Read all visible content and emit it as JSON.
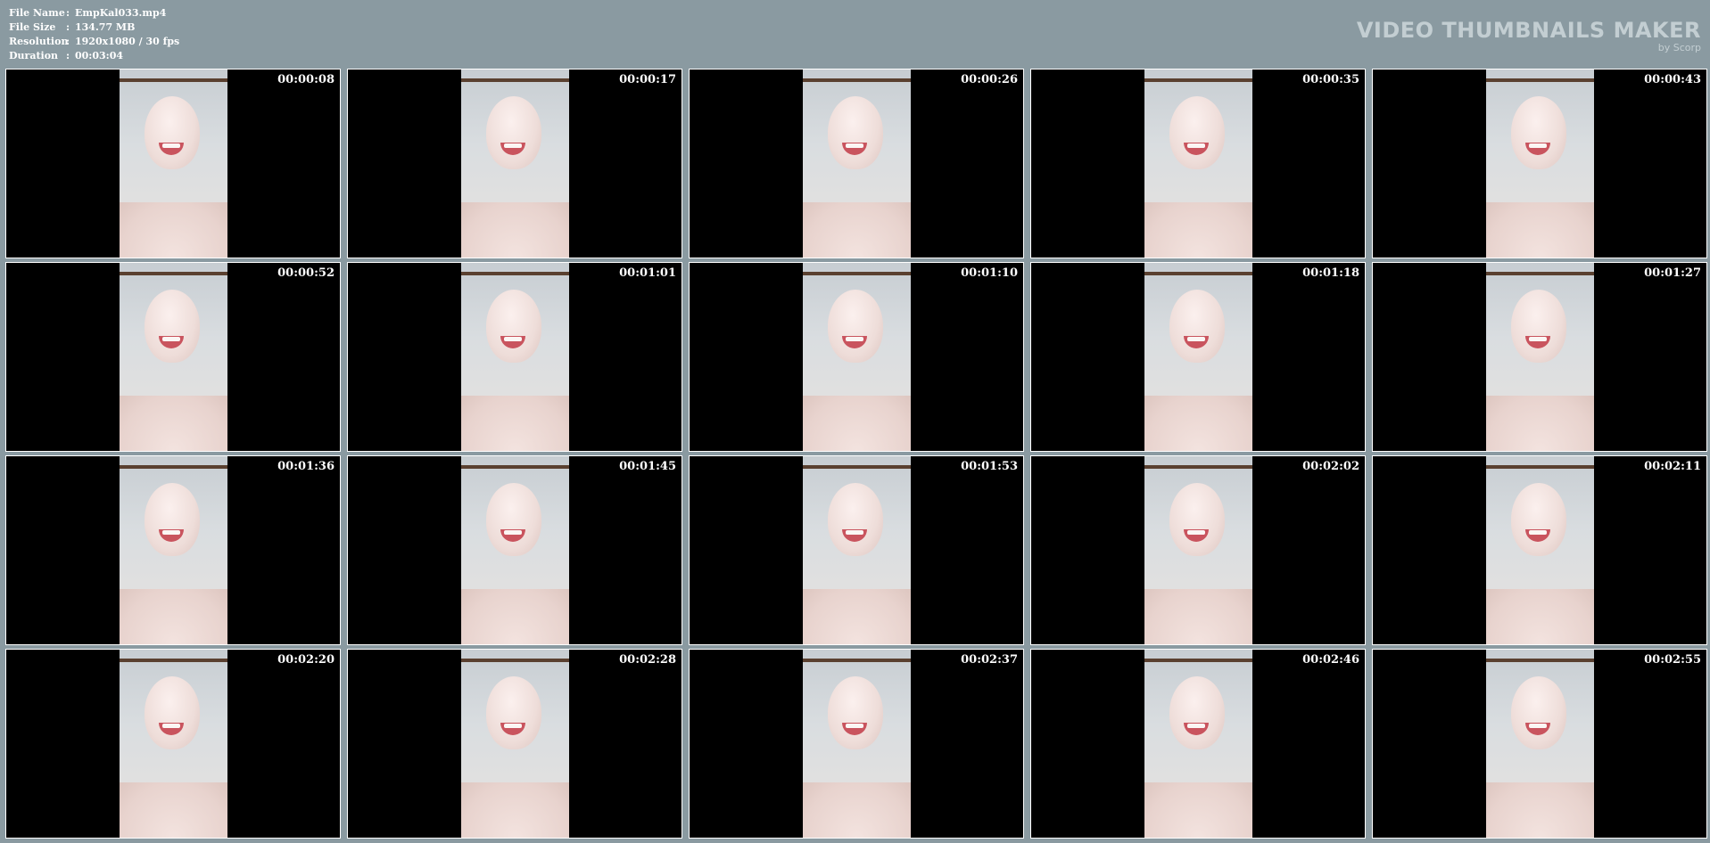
{
  "meta": {
    "rows": [
      {
        "label": "File Name",
        "value": "EmpKal033.mp4"
      },
      {
        "label": "File Size",
        "value": "134.77 MB"
      },
      {
        "label": "Resolution",
        "value": "1920x1080 / 30 fps"
      },
      {
        "label": "Duration",
        "value": "00:03:04"
      }
    ]
  },
  "brand": {
    "title": "VIDEO THUMBNAILS MAKER",
    "by": "by Scorp"
  },
  "thumbnails": [
    "00:00:08",
    "00:00:17",
    "00:00:26",
    "00:00:35",
    "00:00:43",
    "00:00:52",
    "00:01:01",
    "00:01:10",
    "00:01:18",
    "00:01:27",
    "00:01:36",
    "00:01:45",
    "00:01:53",
    "00:02:02",
    "00:02:11",
    "00:02:20",
    "00:02:28",
    "00:02:37",
    "00:02:46",
    "00:02:55"
  ],
  "colors": {
    "background": "#8a9aa1",
    "brand": "#c3ced2",
    "border": "#ffffff"
  }
}
